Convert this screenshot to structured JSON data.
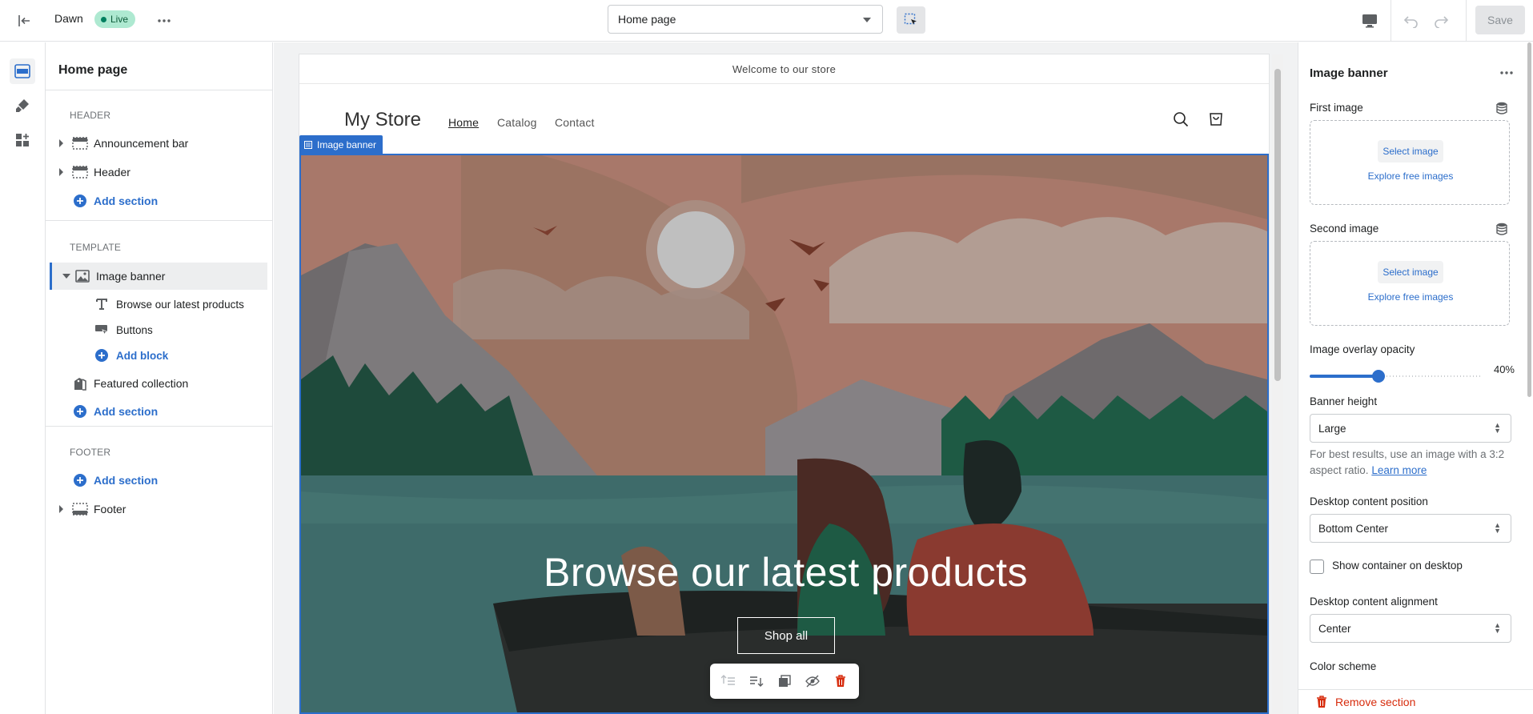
{
  "topbar": {
    "theme_name": "Dawn",
    "status_badge": "Live",
    "page_selector": "Home page",
    "save_label": "Save"
  },
  "sidebar": {
    "title": "Home page",
    "groups": {
      "header": "HEADER",
      "template": "TEMPLATE",
      "footer": "FOOTER"
    },
    "items": {
      "announcement_bar": "Announcement bar",
      "header": "Header",
      "add_section": "Add section",
      "image_banner": "Image banner",
      "block_heading": "Browse our latest products",
      "block_buttons": "Buttons",
      "add_block": "Add block",
      "featured_collection": "Featured collection",
      "footer": "Footer"
    }
  },
  "preview": {
    "announcement": "Welcome to our store",
    "store_name": "My Store",
    "nav": [
      "Home",
      "Catalog",
      "Contact"
    ],
    "section_tag": "Image banner",
    "banner_heading": "Browse our latest products",
    "banner_button": "Shop all"
  },
  "settings": {
    "title": "Image banner",
    "first_image_label": "First image",
    "second_image_label": "Second image",
    "select_image": "Select image",
    "explore_free_images": "Explore free images",
    "overlay_label": "Image overlay opacity",
    "overlay_value": 40,
    "overlay_display": "40%",
    "banner_height_label": "Banner height",
    "banner_height_value": "Large",
    "help_text": "For best results, use an image with a 3:2 aspect ratio.",
    "learn_more": "Learn more",
    "content_position_label": "Desktop content position",
    "content_position_value": "Bottom Center",
    "show_container_label": "Show container on desktop",
    "show_container_checked": false,
    "content_alignment_label": "Desktop content alignment",
    "content_alignment_value": "Center",
    "color_scheme_label": "Color scheme",
    "remove_section": "Remove section"
  },
  "colors": {
    "accent": "#2c6ecb",
    "danger": "#d72c0d",
    "live_badge": "#aee9d1"
  }
}
